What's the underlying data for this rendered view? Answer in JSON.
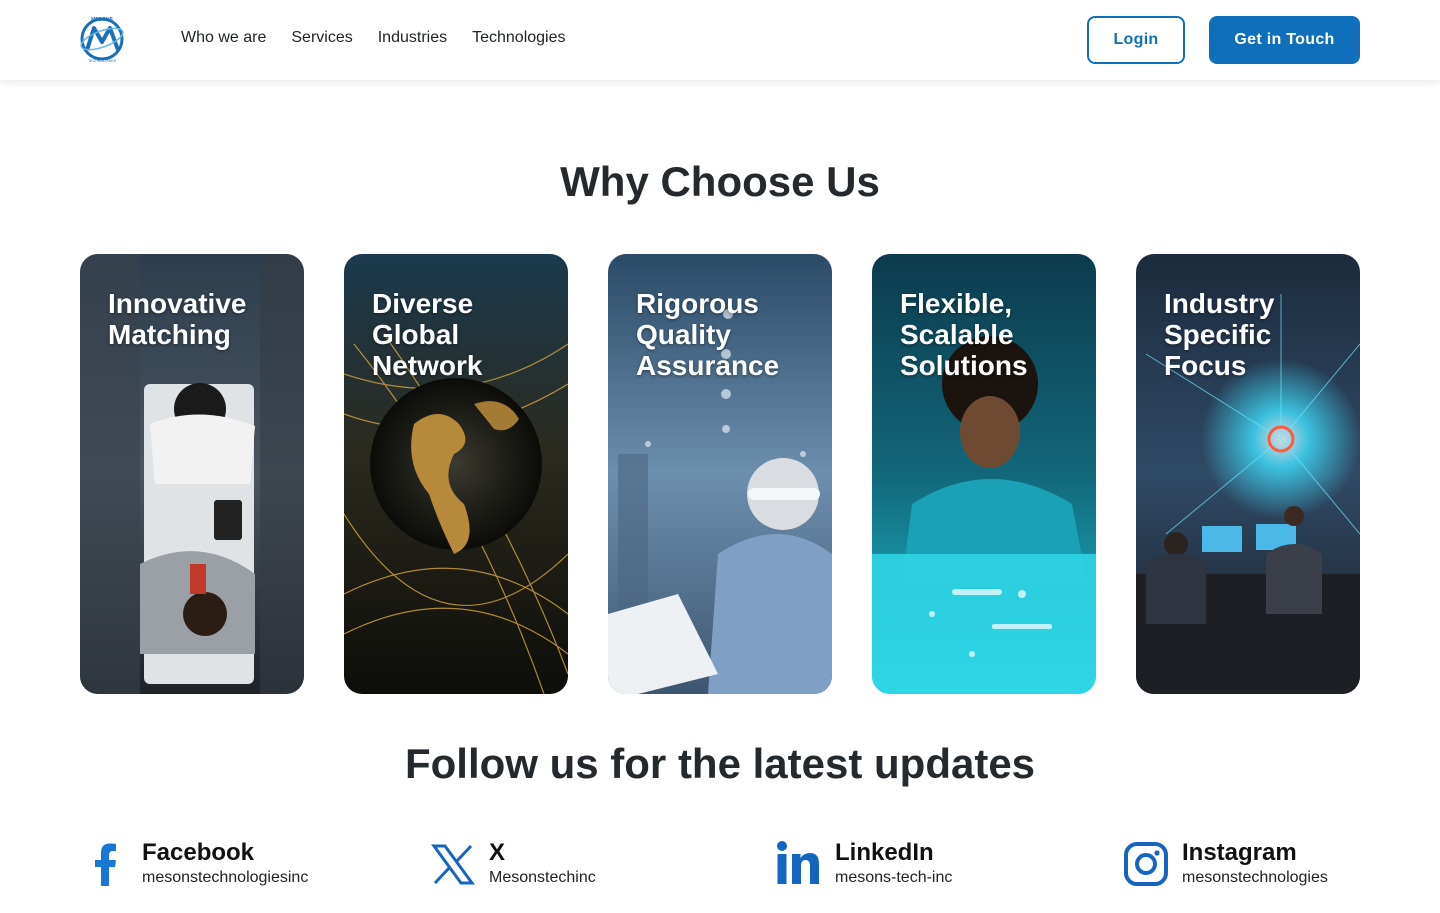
{
  "header": {
    "logo_text": "MESONS TECHNOLOGIES",
    "nav": [
      "Who we are",
      "Services",
      "Industries",
      "Technologies"
    ],
    "login_label": "Login",
    "contact_label": "Get in Touch"
  },
  "why": {
    "title": "Why Choose Us",
    "cards": [
      {
        "title": "Innovative Matching",
        "image": "business-meeting-photo"
      },
      {
        "title": "Diverse Global Network",
        "image": "globe-network-photo"
      },
      {
        "title": "Rigorous Quality Assurance",
        "image": "engineer-warehouse-photo"
      },
      {
        "title": "Flexible, Scalable Solutions",
        "image": "woman-touchscreen-photo"
      },
      {
        "title": "Industry Specific Focus",
        "image": "tech-office-photo"
      }
    ]
  },
  "follow": {
    "title": "Follow us for the latest updates",
    "socials": [
      {
        "name": "Facebook",
        "handle": "mesonstechnologiesinc",
        "icon": "facebook-icon"
      },
      {
        "name": "X",
        "handle": "Mesonstechinc",
        "icon": "x-icon"
      },
      {
        "name": "LinkedIn",
        "handle": "mesons-tech-inc",
        "icon": "linkedin-icon"
      },
      {
        "name": "Instagram",
        "handle": "mesonstechnologies",
        "icon": "instagram-icon"
      }
    ]
  },
  "colors": {
    "brand": "#0f6fba",
    "title": "#24292e"
  }
}
